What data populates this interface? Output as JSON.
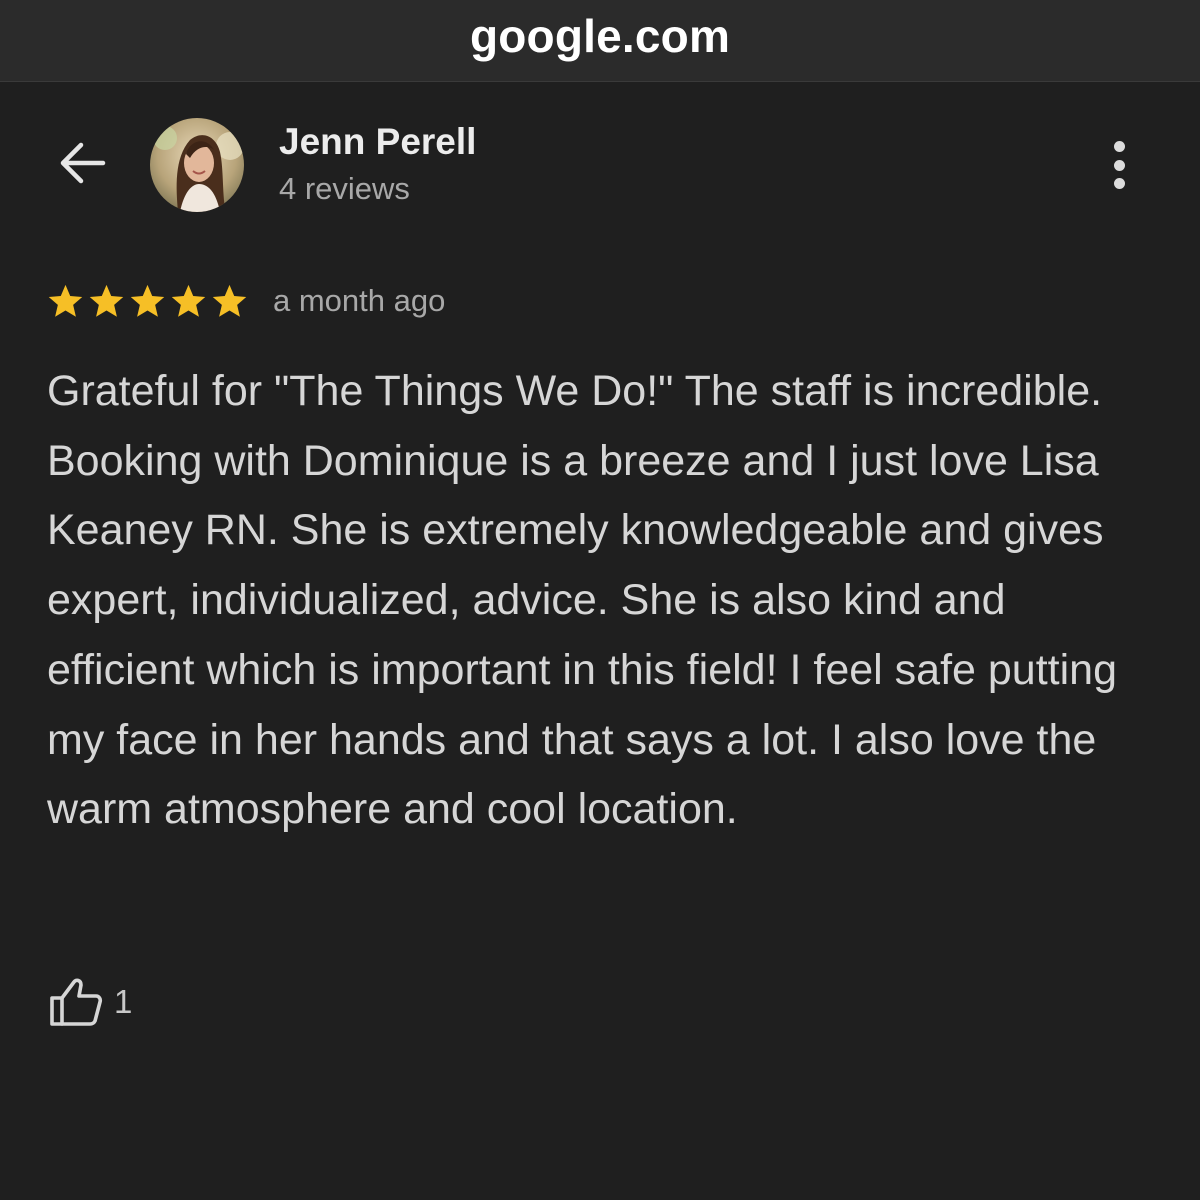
{
  "browser": {
    "url": "google.com"
  },
  "header": {
    "back_icon": "arrow-left-icon",
    "reviewer_name": "Jenn Perell",
    "review_count": "4 reviews",
    "more_icon": "more-vert-icon"
  },
  "review": {
    "rating": 5,
    "rating_max": 5,
    "star_color": "#f6bf26",
    "date": "a month ago",
    "text": "Grateful for \"The Things We Do!\" The staff is incredible. Booking with Dominique is a breeze and I just love Lisa Keaney RN. She is extremely knowledgeable and gives expert, individualized, advice. She is also kind and efficient which is important in this field! I feel safe putting my face in her hands and that says a lot. I also love the warm atmosphere and cool location.",
    "like_icon": "thumbs-up-icon",
    "likes": "1"
  }
}
